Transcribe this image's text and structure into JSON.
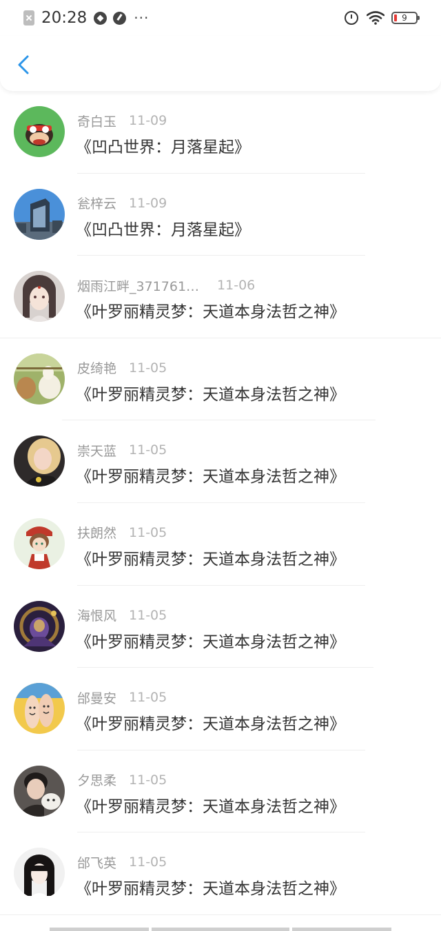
{
  "status_bar": {
    "time": "20:28",
    "battery_level": "9",
    "icons": [
      "app-notification-icon",
      "diamond-app-icon",
      "compass-app-icon",
      "more-dots-icon",
      "alarm-icon",
      "wifi-icon",
      "battery-icon"
    ],
    "more_dots": "···"
  },
  "nav": {
    "back_icon": "chevron-left-icon",
    "accent_color": "#2b95e9"
  },
  "list": {
    "items": [
      {
        "name": "奇白玉",
        "date": "11-09",
        "book": "《凹凸世界：月落星起》",
        "avatar": "cartoon-monkey-avatar"
      },
      {
        "name": "瓮梓云",
        "date": "11-09",
        "book": "《凹凸世界：月落星起》",
        "avatar": "city-building-avatar"
      },
      {
        "name": "烟雨江畔_371761…",
        "date": "11-06",
        "book": "《叶罗丽精灵梦：天道本身法哲之神》",
        "avatar": "anime-girl-avatar"
      },
      {
        "name": "皮绮艳",
        "date": "11-05",
        "book": "《叶罗丽精灵梦：天道本身法哲之神》",
        "avatar": "alpaca-avatar"
      },
      {
        "name": "崇天蓝",
        "date": "11-05",
        "book": "《叶罗丽精灵梦：天道本身法哲之神》",
        "avatar": "blonde-girl-avatar"
      },
      {
        "name": "扶朗然",
        "date": "11-05",
        "book": "《叶罗丽精灵梦：天道本身法哲之神》",
        "avatar": "cartoon-character-avatar"
      },
      {
        "name": "海恨风",
        "date": "11-05",
        "book": "《叶罗丽精灵梦：天道本身法哲之神》",
        "avatar": "game-hero-avatar"
      },
      {
        "name": "邰曼安",
        "date": "11-05",
        "book": "《叶罗丽精灵梦：天道本身法哲之神》",
        "avatar": "finger-faces-avatar"
      },
      {
        "name": "夕思柔",
        "date": "11-05",
        "book": "《叶罗丽精灵梦：天道本身法哲之神》",
        "avatar": "boy-with-dog-avatar"
      },
      {
        "name": "邰飞英",
        "date": "11-05",
        "book": "《叶罗丽精灵梦：天道本身法哲之神》",
        "avatar": "dark-hair-girl-avatar"
      }
    ]
  }
}
